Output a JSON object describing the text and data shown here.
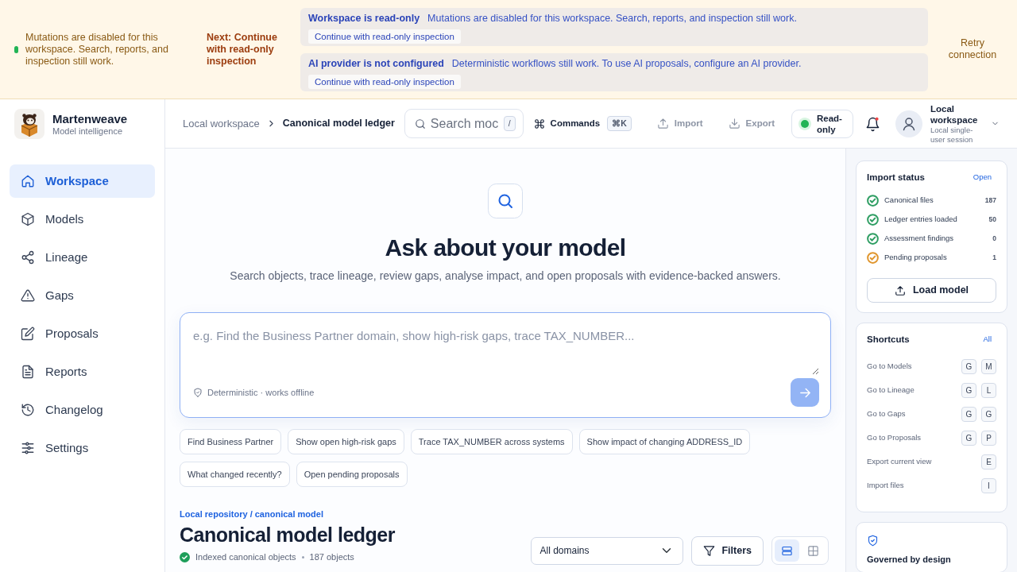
{
  "banner": {
    "message": "Mutations are disabled for this workspace. Search, reports, and inspection still work.",
    "next_step": "Next: Continue with read-only inspection",
    "alerts": [
      {
        "title": "Workspace is read-only",
        "message": "Mutations are disabled for this workspace. Search, reports, and inspection still work.",
        "action": "Continue with read-only inspection"
      },
      {
        "title": "AI provider is not configured",
        "message": "Deterministic workflows still work. To use AI proposals, configure an AI provider.",
        "action": "Continue with read-only inspection"
      }
    ],
    "retry": "Retry connection"
  },
  "sidebar": {
    "brand": {
      "name": "Martenweave",
      "tagline": "Model intelligence"
    },
    "items": [
      {
        "label": "Workspace",
        "selected": true
      },
      {
        "label": "Models",
        "selected": false
      },
      {
        "label": "Lineage",
        "selected": false
      },
      {
        "label": "Gaps",
        "selected": false
      },
      {
        "label": "Proposals",
        "selected": false
      },
      {
        "label": "Reports",
        "selected": false
      },
      {
        "label": "Changelog",
        "selected": false
      },
      {
        "label": "Settings",
        "selected": false
      }
    ]
  },
  "header": {
    "breadcrumb": [
      "Local workspace",
      "Canonical model ledger"
    ],
    "search": {
      "placeholder": "Search moc",
      "shortcut": "/"
    },
    "commands": {
      "label": "Commands",
      "shortcut": "⌘K"
    },
    "actions": [
      {
        "label": "Import",
        "disabled": true
      },
      {
        "label": "Export",
        "disabled": true
      }
    ],
    "mode": {
      "label": "Read-only"
    },
    "notifications": {
      "unread": true
    },
    "account": {
      "name": "Local workspace",
      "session": "Local single-user session"
    }
  },
  "main": {
    "hero": {
      "title": "Ask about your model",
      "subtitle": "Search objects, trace lineage, review gaps, analyse impact, and open proposals with evidence-backed answers."
    },
    "query": {
      "placeholder": "e.g. Find the Business Partner domain, show high-risk gaps, trace TAX_NUMBER...",
      "note": "Deterministic · works offline",
      "send": {
        "disabled": true
      }
    },
    "suggestions": [
      "Find Business Partner",
      "Show open high-risk gaps",
      "Trace TAX_NUMBER across systems",
      "Show impact of changing ADDRESS_ID",
      "What changed recently?",
      "Open pending proposals"
    ],
    "ledger": {
      "eyebrow": "Local repository / canonical model",
      "title": "Canonical model ledger",
      "status": "Indexed canonical objects",
      "count": "187 objects",
      "domain_filter": "All domains",
      "filters_label": "Filters",
      "views": [
        {
          "kind": "list",
          "selected": true
        },
        {
          "kind": "grid",
          "selected": false
        }
      ]
    }
  },
  "right_panel": {
    "import_status": {
      "title": "Import status",
      "link": "Open",
      "items": [
        {
          "label": "Canonical files",
          "count": "187",
          "color": "#2f9e63"
        },
        {
          "label": "Ledger entries loaded",
          "count": "50",
          "color": "#2f9e63"
        },
        {
          "label": "Assessment findings",
          "count": "0",
          "color": "#2f9e63"
        },
        {
          "label": "Pending proposals",
          "count": "1",
          "color": "#e0962e"
        }
      ],
      "button": "Load model"
    },
    "shortcuts": {
      "title": "Shortcuts",
      "link": "All",
      "items": [
        {
          "label": "Go to Models",
          "keys": [
            "G",
            "M"
          ]
        },
        {
          "label": "Go to Lineage",
          "keys": [
            "G",
            "L"
          ]
        },
        {
          "label": "Go to Gaps",
          "keys": [
            "G",
            "G"
          ]
        },
        {
          "label": "Go to Proposals",
          "keys": [
            "G",
            "P"
          ]
        },
        {
          "label": "Export current view",
          "keys": [
            "E"
          ]
        },
        {
          "label": "Import files",
          "keys": [
            "I"
          ]
        }
      ]
    },
    "governed": {
      "title": "Governed by design"
    }
  }
}
